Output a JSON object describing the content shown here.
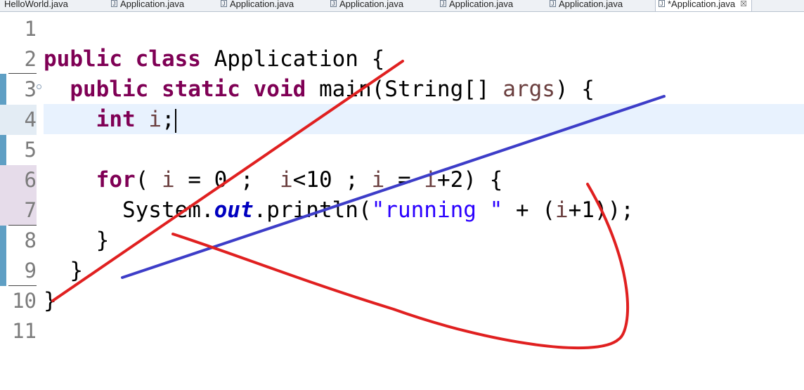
{
  "tabs": [
    {
      "label": "HelloWorld.java",
      "active": false
    },
    {
      "label": "Application.java",
      "active": false
    },
    {
      "label": "Application.java",
      "active": false
    },
    {
      "label": "Application.java",
      "active": false
    },
    {
      "label": "Application.java",
      "active": false
    },
    {
      "label": "Application.java",
      "active": false
    },
    {
      "label": "*Application.java",
      "active": true
    }
  ],
  "tab_icon_glyph": "J",
  "tab_close_glyph": "☒",
  "editor": {
    "line_numbers": [
      "1",
      "2",
      "3",
      "4",
      "5",
      "6",
      "7",
      "8",
      "9",
      "10",
      "11"
    ],
    "current_line": 4,
    "colors": {
      "keyword": "#7f0055",
      "string": "#2a00ff",
      "field": "#0000c0",
      "local_variable": "#6a3e3e",
      "current_line_bg": "#e8f2fe",
      "gutter_marker": "#5f9fc4",
      "annotation_red": "#e02020",
      "annotation_blue": "#3d3dc8"
    },
    "tokens": {
      "kw_public": "public",
      "kw_class": "class",
      "class_name": " Application {",
      "kw_static": "static",
      "kw_void": "void",
      "main_sig": " main(String[] ",
      "var_args": "args",
      "main_end": ") {",
      "kw_int": "int",
      "var_i": "i",
      "semicolon": ";",
      "kw_for": "for",
      "paren_open": "( ",
      "eq_zero": " = 0 ;  ",
      "lt_ten": "<10 ; ",
      "eq": " = ",
      "plus_two": "+2) {",
      "system": "System.",
      "field_out": "out",
      "println": ".println(",
      "str_running": "\"running \"",
      "concat": " + (",
      "plus_one_end": "+1));",
      "brace_close": "}"
    }
  }
}
